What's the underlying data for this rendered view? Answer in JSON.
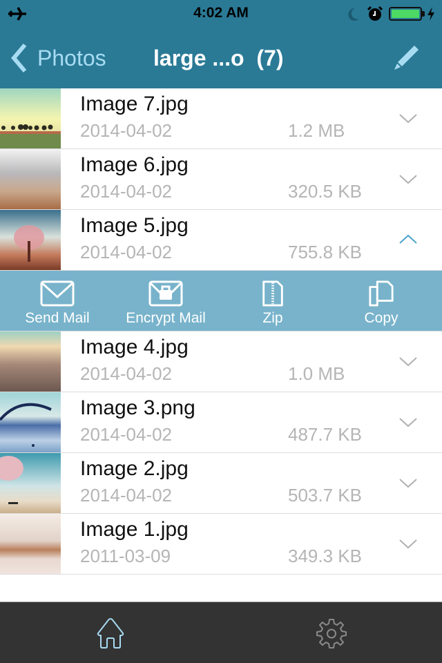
{
  "status_bar": {
    "time": "4:02 AM",
    "icons": [
      "airplane-mode-icon",
      "do-not-disturb-moon-icon",
      "alarm-clock-icon",
      "battery-icon",
      "charging-bolt-icon"
    ],
    "battery_level": 1.0
  },
  "nav": {
    "back_label": "Photos",
    "title": "large ...o  (7)",
    "edit_icon": "pencil-icon"
  },
  "colors": {
    "header_bg": "#2a7a96",
    "accent_light": "#a8dcf3",
    "action_bar_bg": "#78b3cb",
    "tabbar_bg": "#333333",
    "secondary_text": "#b5b5b5",
    "chevron_expanded": "#4aa3cc"
  },
  "files": [
    {
      "name": "Image 7.jpg",
      "date": "2014-04-02",
      "size": "1.2 MB",
      "expanded": false
    },
    {
      "name": "Image 6.jpg",
      "date": "2014-04-02",
      "size": "320.5 KB",
      "expanded": false
    },
    {
      "name": "Image 5.jpg",
      "date": "2014-04-02",
      "size": "755.8 KB",
      "expanded": true
    },
    {
      "name": "Image 4.jpg",
      "date": "2014-04-02",
      "size": "1.0 MB",
      "expanded": false
    },
    {
      "name": "Image 3.png",
      "date": "2014-04-02",
      "size": "487.7 KB",
      "expanded": false
    },
    {
      "name": "Image 2.jpg",
      "date": "2014-04-02",
      "size": "503.7 KB",
      "expanded": false
    },
    {
      "name": "Image 1.jpg",
      "date": "2011-03-09",
      "size": "349.3 KB",
      "expanded": false
    }
  ],
  "actions": [
    {
      "label": "Send Mail",
      "icon": "envelope-icon"
    },
    {
      "label": "Encrypt Mail",
      "icon": "locked-envelope-icon"
    },
    {
      "label": "Zip",
      "icon": "zip-file-icon"
    },
    {
      "label": "Copy",
      "icon": "copy-icon"
    }
  ],
  "tabbar": {
    "tabs": [
      {
        "name": "home",
        "icon": "home-icon",
        "selected": true
      },
      {
        "name": "settings",
        "icon": "gear-icon",
        "selected": false
      }
    ]
  }
}
